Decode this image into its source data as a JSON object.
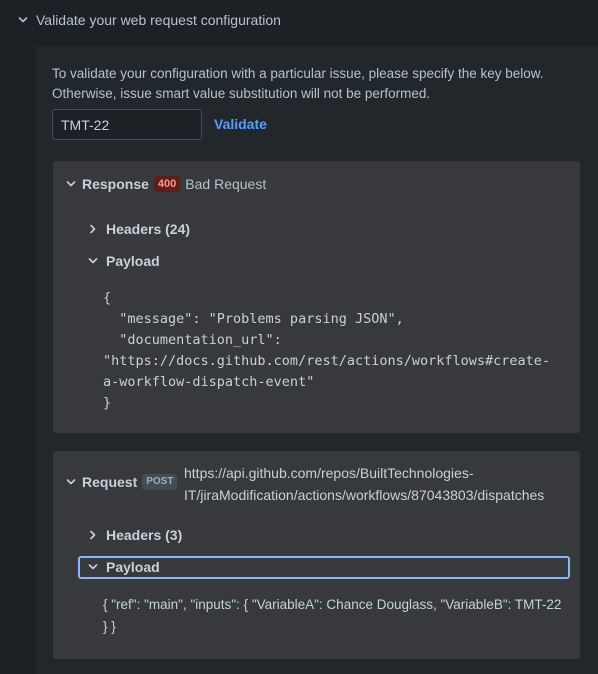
{
  "section": {
    "title": "Validate your web request configuration"
  },
  "intro": {
    "text": "To validate your configuration with a particular issue, please specify the key below. Otherwise, issue smart value substitution will not be performed."
  },
  "issue_input": {
    "value": "TMT-22"
  },
  "validate_label": "Validate",
  "response": {
    "label": "Response",
    "status_code": "400",
    "status_text": "Bad Request",
    "headers_label": "Headers (24)",
    "payload_label": "Payload",
    "payload": "{\n  \"message\": \"Problems parsing JSON\",\n  \"documentation_url\":\n\"https://docs.github.com/rest/actions/workflows#create-\na-workflow-dispatch-event\"\n}"
  },
  "request": {
    "label": "Request",
    "method": "POST",
    "url": "https://api.github.com/repos/BuiltTechnologies-IT/jiraModification/actions/workflows/87043803/dispatches",
    "headers_label": "Headers (3)",
    "payload_label": "Payload",
    "payload": "{ \"ref\": \"main\", \"inputs\": { \"VariableA\": Chance Douglass, \"VariableB\": TMT-22 } }"
  },
  "colors": {
    "background": "#1d2125",
    "panel": "#22272b",
    "card": "#37393c",
    "link": "#579dff",
    "error_badge": "#5d1f1a",
    "focus_ring": "#85b8ff"
  }
}
